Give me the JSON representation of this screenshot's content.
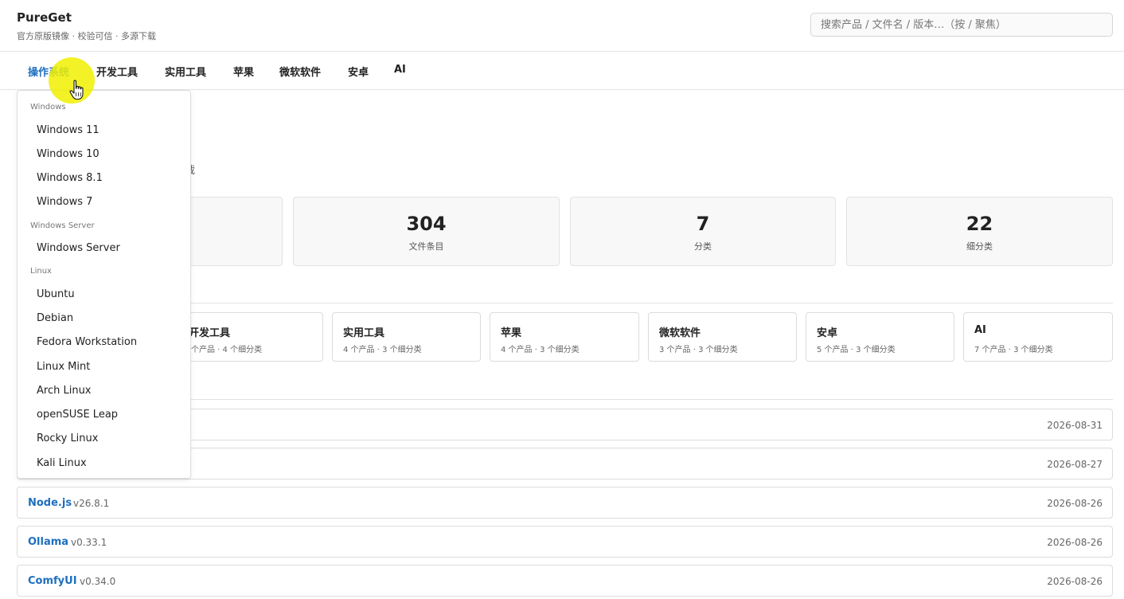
{
  "header": {
    "title": "PureGet",
    "subtitle": "官方原版镜像 · 校验可信 · 多源下载",
    "search_placeholder": "搜索产品 / 文件名 / 版本…（按 / 聚焦）"
  },
  "nav": {
    "items": [
      "操作系统",
      "开发工具",
      "实用工具",
      "苹果",
      "微软软件",
      "安卓",
      "AI"
    ],
    "active_index": 0
  },
  "hero": {
    "visible_fragment": "载"
  },
  "stats": [
    {
      "value": "304",
      "label": "文件条目"
    },
    {
      "value": "7",
      "label": "分类"
    },
    {
      "value": "22",
      "label": "细分类"
    }
  ],
  "categories": [
    {
      "name": "开发工具",
      "meta": "个产品 · 4 个细分类"
    },
    {
      "name": "实用工具",
      "meta": "4 个产品 · 3 个细分类"
    },
    {
      "name": "苹果",
      "meta": "4 个产品 · 3 个细分类"
    },
    {
      "name": "微软软件",
      "meta": "3 个产品 · 3 个细分类"
    },
    {
      "name": "安卓",
      "meta": "5 个产品 · 3 个细分类"
    },
    {
      "name": "AI",
      "meta": "7 个产品 · 3 个细分类"
    }
  ],
  "releases": [
    {
      "name": "",
      "version": "",
      "date": "2026-08-31"
    },
    {
      "name": "",
      "version": "",
      "date": "2026-08-27"
    },
    {
      "name": "Node.js",
      "version": "v26.8.1",
      "date": "2026-08-26"
    },
    {
      "name": "Ollama",
      "version": "v0.33.1",
      "date": "2026-08-26"
    },
    {
      "name": "ComfyUI",
      "version": "v0.34.0",
      "date": "2026-08-26"
    }
  ],
  "dropdown": {
    "groups": [
      {
        "label": "Windows",
        "items": [
          "Windows 11",
          "Windows 10",
          "Windows 8.1",
          "Windows 7"
        ]
      },
      {
        "label": "Windows Server",
        "items": [
          "Windows Server"
        ]
      },
      {
        "label": "Linux",
        "items": [
          "Ubuntu",
          "Debian",
          "Fedora Workstation",
          "Linux Mint",
          "Arch Linux",
          "openSUSE Leap",
          "Rocky Linux",
          "Kali Linux"
        ]
      }
    ]
  },
  "colors": {
    "accent": "#1d6fbf",
    "cursor_highlight": "#f0f000"
  },
  "icons": {
    "cursor": "hand-pointer-icon"
  }
}
